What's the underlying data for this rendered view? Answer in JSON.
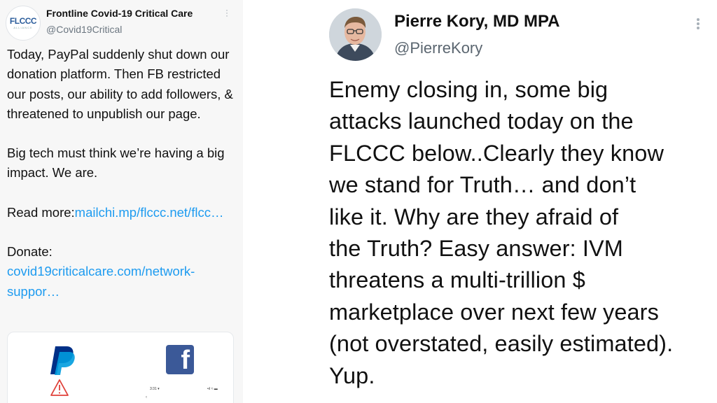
{
  "left_tweet": {
    "avatar_text": "FLCCC",
    "avatar_subtext": "ALLIANCE",
    "author_name": "Frontline Covid-19 Critical Care",
    "author_handle": "@Covid19Critical",
    "paragraph_1": "Today, PayPal suddenly shut down our donation platform. Then FB restricted our posts, our ability to add followers, & threatened to unpublish our page.",
    "paragraph_2": "Big tech must think we’re having a big impact. We are.",
    "read_more_label": "Read more:",
    "read_more_link": "mailchi.mp/flccc.net/flcc…",
    "donate_label": "Donate: ",
    "donate_link": "covid19criticalcare.com/network-suppor…",
    "card": {
      "paypal_icon": "paypal-logo-icon",
      "facebook_icon": "facebook-logo-icon",
      "facebook_glyph": "f",
      "warning_icon": "warning-triangle-icon",
      "mini_time": "3:31 ▾",
      "mini_status": "•ıl ≈ ▬",
      "mini_arrow": "‹"
    }
  },
  "right_tweet": {
    "author_name": "Pierre Kory, MD MPA",
    "author_handle": "@PierreKory",
    "lines": [
      "Enemy closing in, some big",
      "attacks launched today on the",
      "FLCCC below..Clearly they know",
      "we stand for Truth… and don’t",
      "like it. Why are they afraid of",
      "the Truth? Easy answer: IVM",
      "threatens a multi-trillion $",
      "marketplace over next few years",
      "(not overstated, easily estimated).",
      "Yup."
    ]
  },
  "colors": {
    "link": "#1d9bf0",
    "facebook_blue": "#3b5998",
    "paypal_dark": "#003087",
    "paypal_light": "#009cde",
    "warning_red": "#e0413a"
  }
}
